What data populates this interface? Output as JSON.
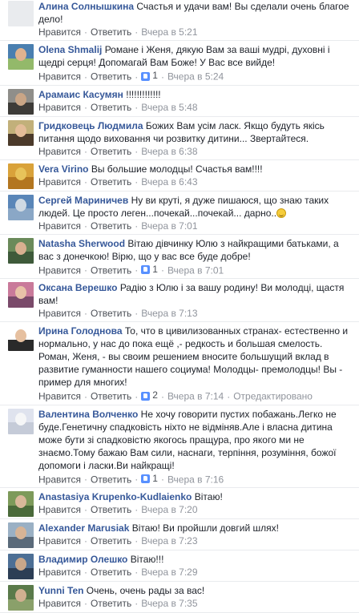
{
  "ui": {
    "like": "Нравится",
    "reply": "Ответить",
    "dot": "·"
  },
  "comments": [
    {
      "author": "Алина Солнышкина",
      "text": "Счастья и удачи вам! Вы сделали очень благое дело!",
      "time": "Вчера в 5:21",
      "likes": "",
      "edited": "",
      "avatar": [
        "#e9ebee",
        "#e9ebee",
        "#e9ebee"
      ]
    },
    {
      "author": "Olena Shmalij",
      "text": "Романе і Женя, дякую Вам за ваші мудрі, духовні і щедрі серця! Допомагай Вам Боже! У Вас все вийде!",
      "time": "Вчера в 5:24",
      "likes": "1",
      "edited": "",
      "avatar": [
        "#4a7fb0",
        "#93b96a",
        "#e0b38f"
      ]
    },
    {
      "author": "Арамаис Касумян",
      "text": "!!!!!!!!!!!!!",
      "time": "Вчера в 5:48",
      "likes": "",
      "edited": "",
      "avatar": [
        "#8f8e8a",
        "#3d3b38",
        "#c9a586"
      ]
    },
    {
      "author": "Гридковець Людмила",
      "text": "Божих Вам усім ласк. Якщо будуть якісь питання щодо виховання чи розвитку дитини... Звертайтеся.",
      "time": "Вчера в 6:38",
      "likes": "",
      "edited": "",
      "avatar": [
        "#c2b07a",
        "#4b3a2a",
        "#e3bc98"
      ]
    },
    {
      "author": "Vera Virino",
      "text": "Вы большие молодцы! Счастья вам!!!!",
      "time": "Вчера в 6:43",
      "likes": "",
      "edited": "",
      "avatar": [
        "#d9a23a",
        "#b37620",
        "#e8c35a"
      ]
    },
    {
      "author": "Сергей Мариничев",
      "text": "Ну ви круті, я дуже пишаюся, що знаю таких людей. Це просто леген...почекай...почекай... дарно..",
      "time": "Вчера в 7:01",
      "likes": "",
      "edited": "",
      "avatar": [
        "#5a86b8",
        "#8aa7c6",
        "#cfd9e3"
      ]
    },
    {
      "author": "Natasha Sherwood",
      "text": "Вітаю дівчинку Юлю з найкращими батьками, а вас з донечкою! Вірю, що у вас все буде добре!",
      "time": "Вчера в 7:01",
      "likes": "1",
      "edited": "",
      "avatar": [
        "#6a8a5a",
        "#3e5a3a",
        "#d8b090"
      ]
    },
    {
      "author": "Оксана Верешко",
      "text": "Радію з Юлю і за вашу родину! Ви молодці, щастя вам!",
      "time": "Вчера в 7:13",
      "likes": "",
      "edited": "",
      "avatar": [
        "#c97a9a",
        "#7a4a6a",
        "#e8c2a8"
      ]
    },
    {
      "author": "Ирина Голоднова",
      "text": "То, что в цивилизованных странах- естественно и нормально, у нас до пока ещё ,- редкость и большая смелость. Роман, Женя, - вы своим решением вносите большущий вклад в развитие гуманности нашего социума! Молодцы- премолодцы! Вы - пример для многих!",
      "time": "Вчера в 7:14",
      "likes": "2",
      "edited": "Отредактировано",
      "avatar": [
        "#ffffff",
        "#2a2a2a",
        "#e6c0a0"
      ]
    },
    {
      "author": "Валентина Волченко",
      "text": "Не хочу говорити пустих побажань.Легко не буде.Генетичну спадковість ніхто не відміняв.Але і власна дитина може бути зі спадковістю якогось пращура, про якого ми не знаємо.Тому бажаю Вам сили, наснаги, терпіння, розуміння, божої допомоги і ласки.Ви найкращі!",
      "time": "Вчера в 7:16",
      "likes": "1",
      "edited": "",
      "avatar": [
        "#dfe3ee",
        "#c5cbd8",
        "#f5f6f7"
      ]
    },
    {
      "author": "Anastasiya Krupenko-Kudlaienko",
      "text": "Вітаю!",
      "time": "Вчера в 7:20",
      "likes": "",
      "edited": "",
      "avatar": [
        "#7d9a5a",
        "#4a6a3a",
        "#d9b89a"
      ]
    },
    {
      "author": "Alexander Marusiak",
      "text": "Вітаю! Ви пройшли довгий шлях!",
      "time": "Вчера в 7:23",
      "likes": "",
      "edited": "",
      "avatar": [
        "#9ab0c4",
        "#5a6a7a",
        "#d7b496"
      ]
    },
    {
      "author": "Владимир Олешко",
      "text": "Вітаю!!!",
      "time": "Вчера в 7:29",
      "likes": "",
      "edited": "",
      "avatar": [
        "#4d6f95",
        "#2c3e55",
        "#c9a78a"
      ]
    },
    {
      "author": "Yunni Ten",
      "text": "Очень, очень рады за вас!",
      "time": "Вчера в 7:35",
      "likes": "",
      "edited": "",
      "avatar": [
        "#5a7a4a",
        "#8aa06a",
        "#d0b090"
      ]
    }
  ]
}
